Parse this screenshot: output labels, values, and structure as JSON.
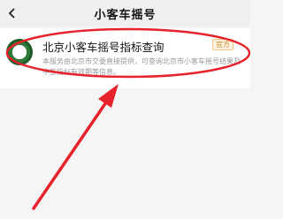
{
  "header": {
    "title": "小客车摇号",
    "back_icon": "chevron-left-icon"
  },
  "result": {
    "name": "北京小客车摇号指标查询",
    "badge": "官方",
    "description": "本服务由北京市交委直接提供，可查询北京市小客车摇号结果及中签指标有效期等信息。",
    "logo_icon": "beijing-traffic-emblem-icon"
  },
  "annotation": {
    "color": "#e8222a"
  }
}
